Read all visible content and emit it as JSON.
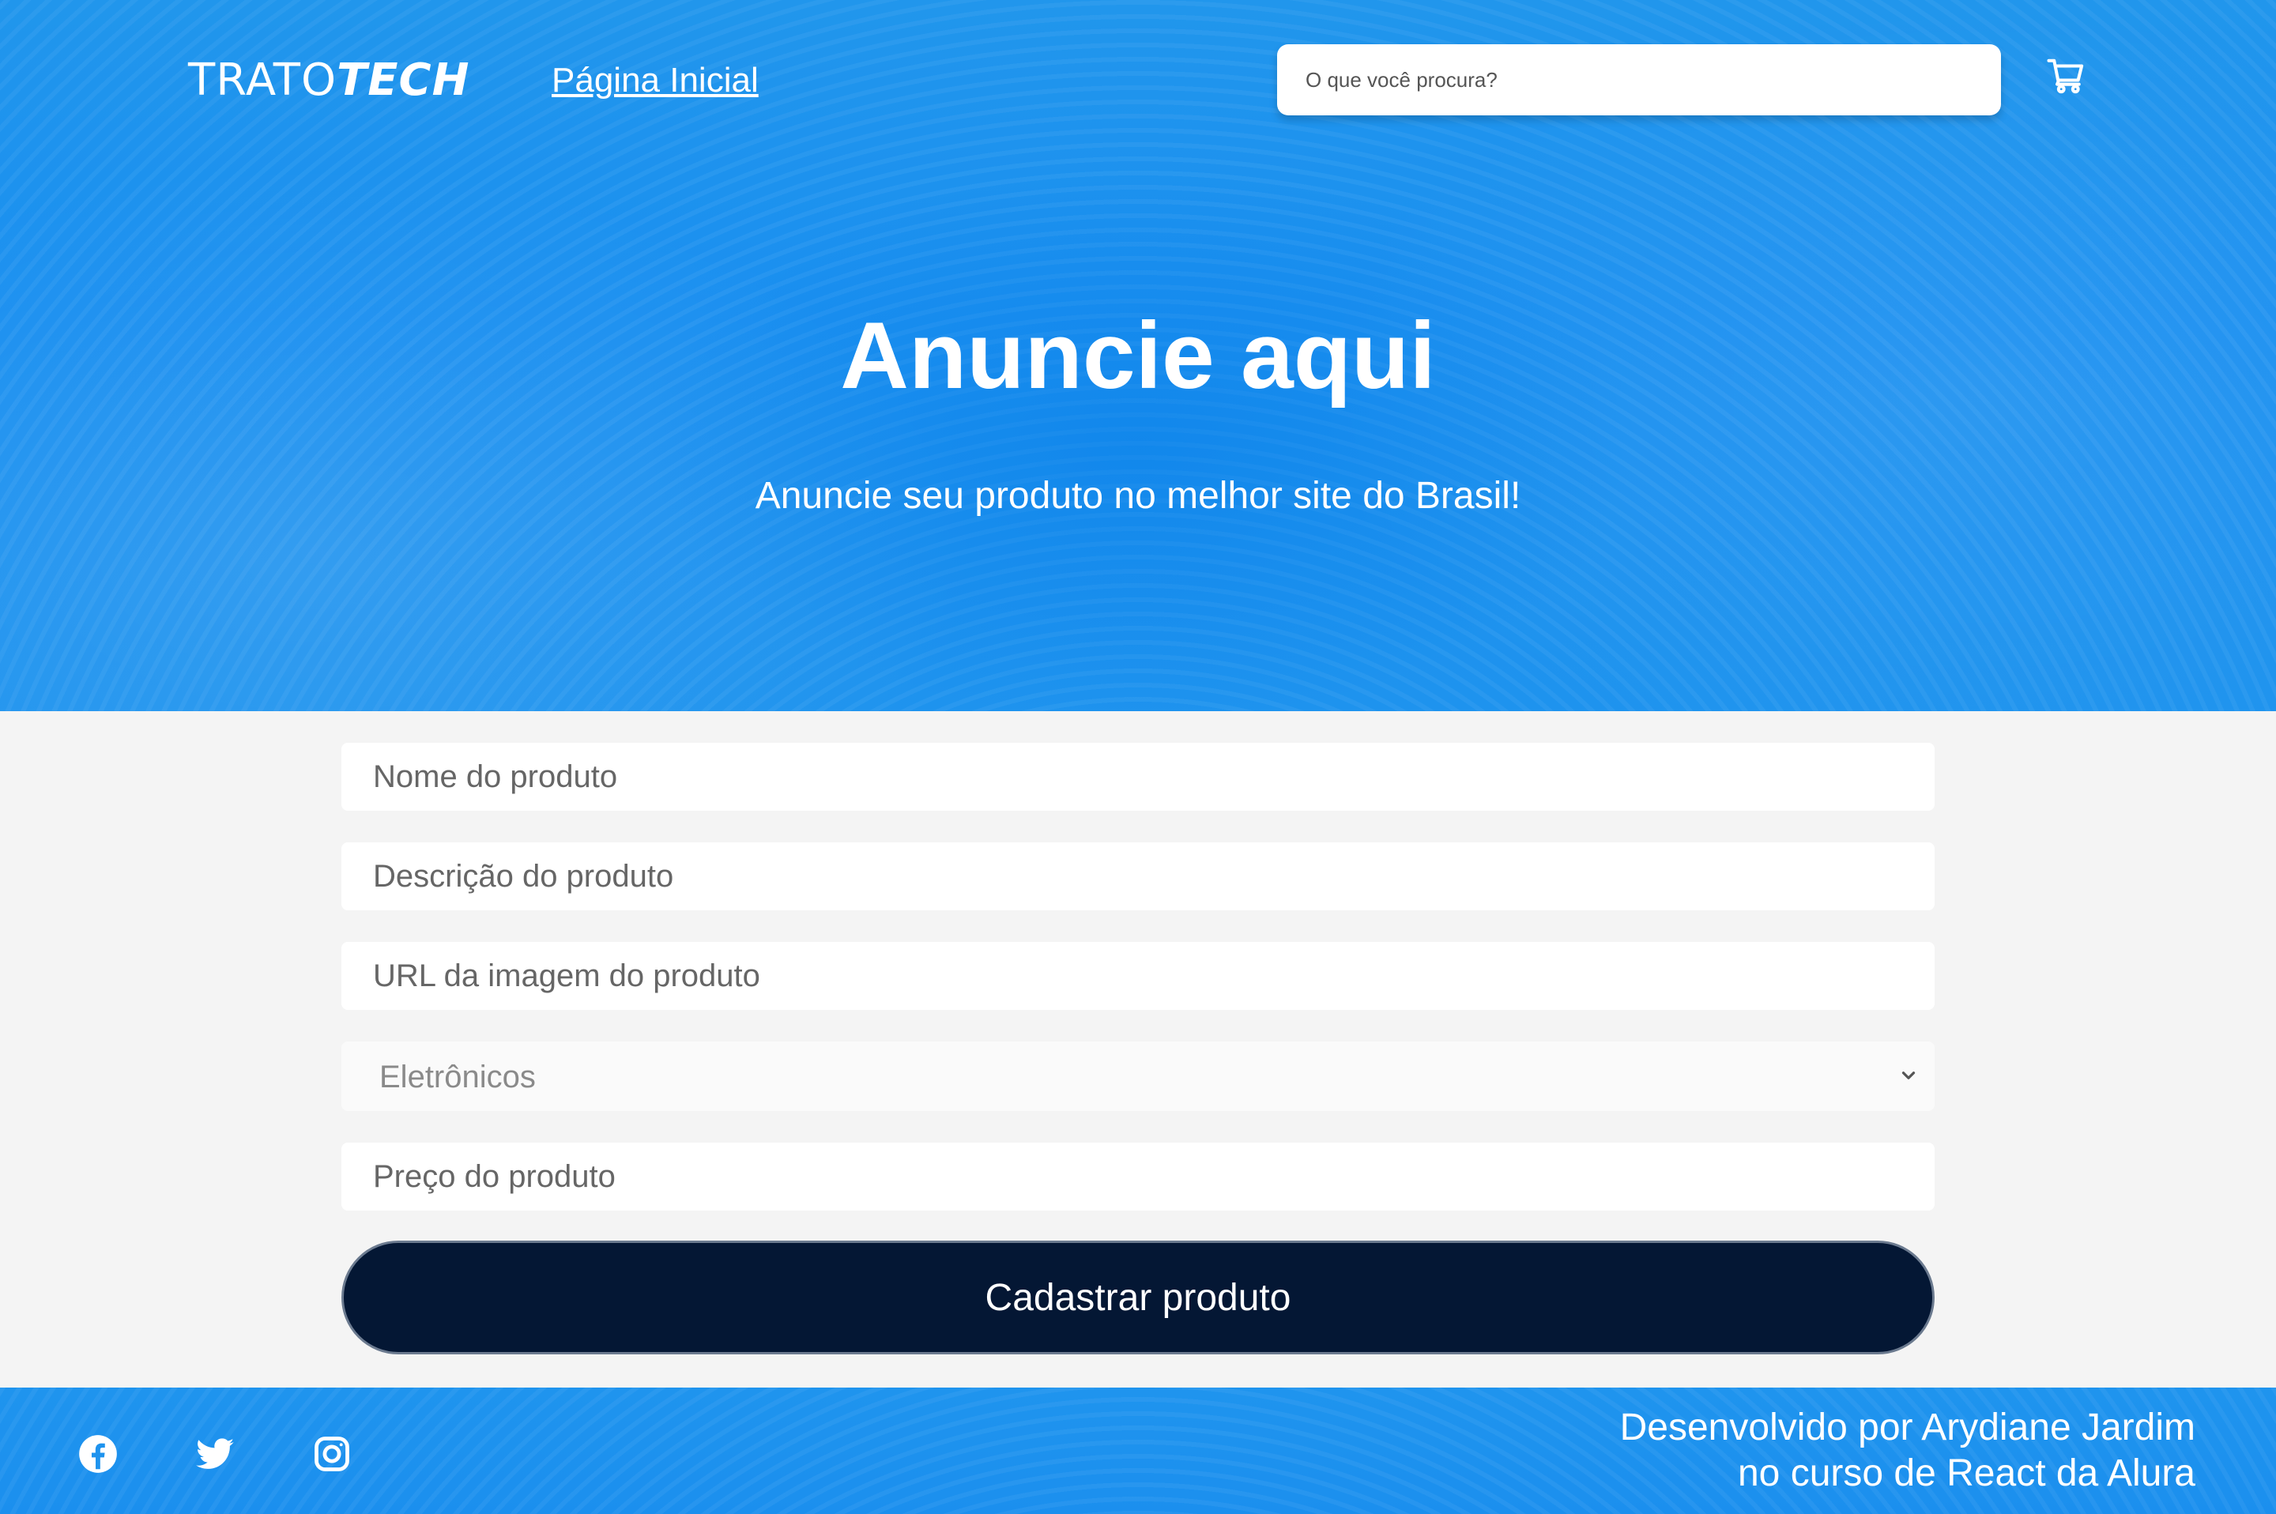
{
  "header": {
    "logo_light": "TRATO",
    "logo_bold": "TECH",
    "home_link": "Página Inicial",
    "search_placeholder": "O que você procura?",
    "cart_icon": "cart-icon"
  },
  "hero": {
    "title": "Anuncie aqui",
    "subtitle": "Anuncie seu produto no melhor site do Brasil!"
  },
  "form": {
    "name_placeholder": "Nome do produto",
    "description_placeholder": "Descrição do produto",
    "image_url_placeholder": "URL da imagem do produto",
    "category_selected": "Eletrônicos",
    "price_placeholder": "Preço do produto",
    "submit_label": "Cadastrar produto"
  },
  "footer": {
    "social_icons": [
      "facebook-icon",
      "twitter-icon",
      "instagram-icon"
    ],
    "credit_line1": "Desenvolvido por Arydiane Jardim",
    "credit_line2": "no curso de React da Alura"
  },
  "colors": {
    "brand_blue": "#1e93ee",
    "button_navy": "#041734",
    "page_background": "#f4f4f4"
  }
}
